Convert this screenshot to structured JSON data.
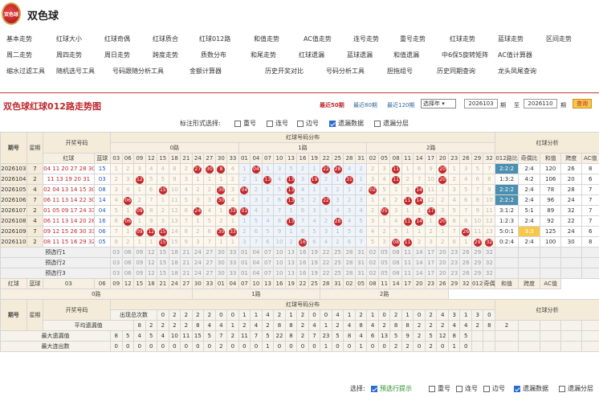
{
  "site": {
    "title": "双色球",
    "logo_text": "双色球"
  },
  "nav": [
    [
      "基本走势",
      "红球大小",
      "红球奇偶",
      "红球质合",
      "红球012路",
      "和值走势",
      "AC值走势",
      "连号走势",
      "重号走势",
      "红球走势",
      "蓝球走势",
      "区间走势"
    ],
    [
      "周二走势",
      "周四走势",
      "周日走势",
      "跨度走势",
      "质数分布",
      "和尾走势",
      "红球遗漏",
      "蓝球遗漏",
      "和值遗漏",
      "中6保5旋转矩阵",
      "AC值计算器"
    ],
    [
      "缩水过滤工具",
      "随机选号工具",
      "号码跟随分析工具",
      "金额计算器",
      "历史开奖对比",
      "号码分析工具",
      "胆拖组号",
      "历史同期查询",
      "龙头凤尾查询"
    ]
  ],
  "chart": {
    "title": "双色球红球012路走势图",
    "filters": [
      "最近50期",
      "最近80期",
      "最近120期"
    ],
    "select_value": "选择年",
    "from_issue": "2026103",
    "to_issue": "2026110",
    "unit": "期",
    "to_label": "至",
    "query_label": "查询"
  },
  "options": {
    "label": "标注形式选择:",
    "items": [
      "重号",
      "连号",
      "边号",
      "遗漏数据",
      "遗漏分层"
    ],
    "checked": [
      false,
      false,
      false,
      true,
      false
    ]
  },
  "headers": {
    "period": "期号",
    "week": "星期",
    "open": "开奖号码",
    "red": "红球",
    "blue": "蓝球",
    "dist": "红球号码分布",
    "road0": "0路",
    "road1": "1路",
    "road2": "2路",
    "analysis": "红球分析",
    "ana_cols": [
      "012路比",
      "奇偶比",
      "和值",
      "跨度",
      "AC值"
    ]
  },
  "road0_nums": [
    "03",
    "06",
    "09",
    "12",
    "15",
    "18",
    "21",
    "24",
    "27",
    "30",
    "33"
  ],
  "road1_nums": [
    "01",
    "04",
    "07",
    "10",
    "13",
    "16",
    "19",
    "22",
    "25",
    "28",
    "31"
  ],
  "road2_nums": [
    "02",
    "05",
    "08",
    "11",
    "14",
    "17",
    "20",
    "23",
    "26",
    "29",
    "32"
  ],
  "rows": [
    {
      "p": "2026103",
      "w": "7",
      "red": "04 11 20 27 28 30",
      "blue": "15",
      "r0": [
        1,
        2,
        3,
        4,
        4,
        8,
        2,
        "27",
        "30",
        "8",
        4
      ],
      "r1": [
        1,
        "04",
        1,
        3,
        5,
        2,
        1,
        "22?",
        "28",
        4,
        2
      ],
      "r2": [
        2,
        3,
        "11",
        1,
        6,
        9,
        "20",
        1,
        3,
        5,
        7
      ],
      "ratio": "2:2:2",
      "oe": "2:4",
      "sum": "120",
      "span": "26",
      "ac": "8"
    },
    {
      "p": "2026104",
      "w": "2",
      "red": "11 13 19 20 31",
      "blue": "03",
      "r0": [
        2,
        3,
        "12",
        5,
        5,
        9,
        3,
        1,
        1,
        1,
        2
      ],
      "r1": [
        2,
        1,
        "13",
        4,
        "13",
        3,
        "19",
        2,
        1,
        "31",
        1
      ],
      "r2": [
        3,
        4,
        "11",
        2,
        7,
        10,
        "20",
        2,
        4,
        6,
        8
      ],
      "ratio": "1:3:2",
      "oe": "4:2",
      "sum": "106",
      "span": "20",
      "ac": "6"
    },
    {
      "p": "2026105",
      "w": "4",
      "red": "02 04 13 14 15 30",
      "blue": "08",
      "r0": [
        3,
        4,
        1,
        6,
        "15",
        10,
        4,
        2,
        2,
        "30",
        3
      ],
      "r1": [
        "04",
        2,
        1,
        5,
        "13",
        4,
        1,
        3,
        2,
        1,
        2
      ],
      "r2": [
        "02",
        5,
        1,
        3,
        "14",
        11,
        1,
        3,
        5,
        7,
        9
      ],
      "ratio": "2:2:2",
      "oe": "2:4",
      "sum": "78",
      "span": "28",
      "ac": "7"
    },
    {
      "p": "2026106",
      "w": "7",
      "red": "06 11 13 14 22 30",
      "blue": "14",
      "r0": [
        4,
        "06",
        2,
        7,
        1,
        11,
        5,
        3,
        3,
        "30",
        4
      ],
      "r1": [
        1,
        3,
        2,
        6,
        "13",
        5,
        2,
        "22",
        3,
        2,
        3
      ],
      "r2": [
        1,
        6,
        2,
        "11",
        "14",
        12,
        2,
        4,
        6,
        8,
        10
      ],
      "ratio": "2:2:2",
      "oe": "2:4",
      "sum": "96",
      "span": "24",
      "ac": "7"
    },
    {
      "p": "2026107",
      "w": "2",
      "red": "01 05 09 17 24 33",
      "blue": "04",
      "r0": [
        5,
        1,
        "09",
        8,
        2,
        12,
        6,
        "24",
        4,
        1,
        "33"
      ],
      "r1": [
        "01",
        4,
        3,
        7,
        1,
        6,
        3,
        1,
        4,
        3,
        4
      ],
      "r2": [
        2,
        "05",
        3,
        1,
        1,
        "17",
        3,
        5,
        7,
        9,
        11
      ],
      "ratio": "3:1:2",
      "oe": "5:1",
      "sum": "89",
      "span": "32",
      "ac": "7"
    },
    {
      "p": "2026108",
      "w": "4",
      "red": "06 11 13 14 20 28",
      "blue": "16",
      "r0": [
        6,
        "06",
        1,
        9,
        3,
        13,
        7,
        1,
        5,
        2,
        1
      ],
      "r1": [
        1,
        5,
        4,
        8,
        "13",
        7,
        4,
        2,
        "28",
        4,
        5
      ],
      "r2": [
        3,
        1,
        4,
        "11",
        "14",
        1,
        "20",
        6,
        8,
        10,
        12
      ],
      "ratio": "1:2:3",
      "oe": "2:4",
      "sum": "92",
      "span": "22",
      "ac": "7"
    },
    {
      "p": "2026109",
      "w": "7",
      "red": "09 12 15 26 30 33",
      "blue": "06",
      "r0": [
        7,
        1,
        "09",
        "12",
        "15",
        14,
        8,
        2,
        6,
        "30",
        "33"
      ],
      "r1": [
        2,
        6,
        5,
        9,
        1,
        8,
        5,
        3,
        1,
        5,
        6
      ],
      "r2": [
        4,
        2,
        5,
        1,
        1,
        2,
        1,
        7,
        "26",
        11,
        13
      ],
      "ratio": "5:0:1",
      "oe": "3:3",
      "sum": "125",
      "span": "24",
      "ac": "6"
    },
    {
      "p": "2026110",
      "w": "2",
      "red": "08 11 15 16 29 32",
      "blue": "05",
      "r0": [
        8,
        2,
        1,
        1,
        "15",
        15,
        9,
        3,
        7,
        1,
        1
      ],
      "r1": [
        3,
        7,
        6,
        10,
        2,
        "16",
        6,
        4,
        2,
        6,
        7
      ],
      "r2": [
        5,
        3,
        "08",
        "11",
        2,
        3,
        2,
        8,
        1,
        "29",
        "32"
      ],
      "ratio": "0:2:4",
      "oe": "2:4",
      "sum": "100",
      "span": "30",
      "ac": "8"
    }
  ],
  "preselect": [
    "预选行1",
    "预选行2",
    "预选行3"
  ],
  "stats": [
    {
      "label": "出现总次数",
      "v": [
        "0",
        "2",
        "2",
        "2",
        "2",
        "0",
        "0",
        "1",
        "1",
        "4",
        "2",
        "1",
        "2",
        "0",
        "0",
        "4",
        "1",
        "2",
        "1",
        "0",
        "2",
        "1",
        "0",
        "2",
        "4",
        "3",
        "1",
        "3",
        "0",
        "2",
        "0",
        "1"
      ]
    },
    {
      "label": "平均遗漏值",
      "v": [
        "8",
        "2",
        "2",
        "2",
        "2",
        "8",
        "4",
        "4",
        "1",
        "2",
        "4",
        "2",
        "8",
        "8",
        "2",
        "4",
        "1",
        "2",
        "4",
        "8",
        "4",
        "2",
        "8",
        "8",
        "2",
        "2",
        "2",
        "4",
        "4",
        "2",
        "8",
        "2"
      ]
    },
    {
      "label": "最大遗漏值",
      "v": [
        "8",
        "5",
        "4",
        "5",
        "4",
        "10",
        "11",
        "15",
        "5",
        "7",
        "2",
        "11",
        "7",
        "5",
        "22",
        "8",
        "2",
        "7",
        "23",
        "5",
        "8",
        "4",
        "6",
        "13",
        "5",
        "9",
        "2",
        "5",
        "12",
        "8",
        "5"
      ]
    },
    {
      "label": "最大连出数",
      "v": [
        "0",
        "0",
        "0",
        "0",
        "0",
        "0",
        "0",
        "0",
        "0",
        "2",
        "0",
        "0",
        "0",
        "1",
        "0",
        "0",
        "0",
        "0",
        "1",
        "0",
        "0",
        "1",
        "0",
        "0",
        "2",
        "2",
        "0",
        "2",
        "0",
        "1",
        "0"
      ]
    }
  ],
  "legend": {
    "label": "选择:",
    "link": "预选行提示",
    "items": [
      "重号",
      "连号",
      "边号",
      "遗漏数据",
      "遗漏分层"
    ],
    "checked": [
      false,
      false,
      false,
      true,
      false
    ]
  }
}
